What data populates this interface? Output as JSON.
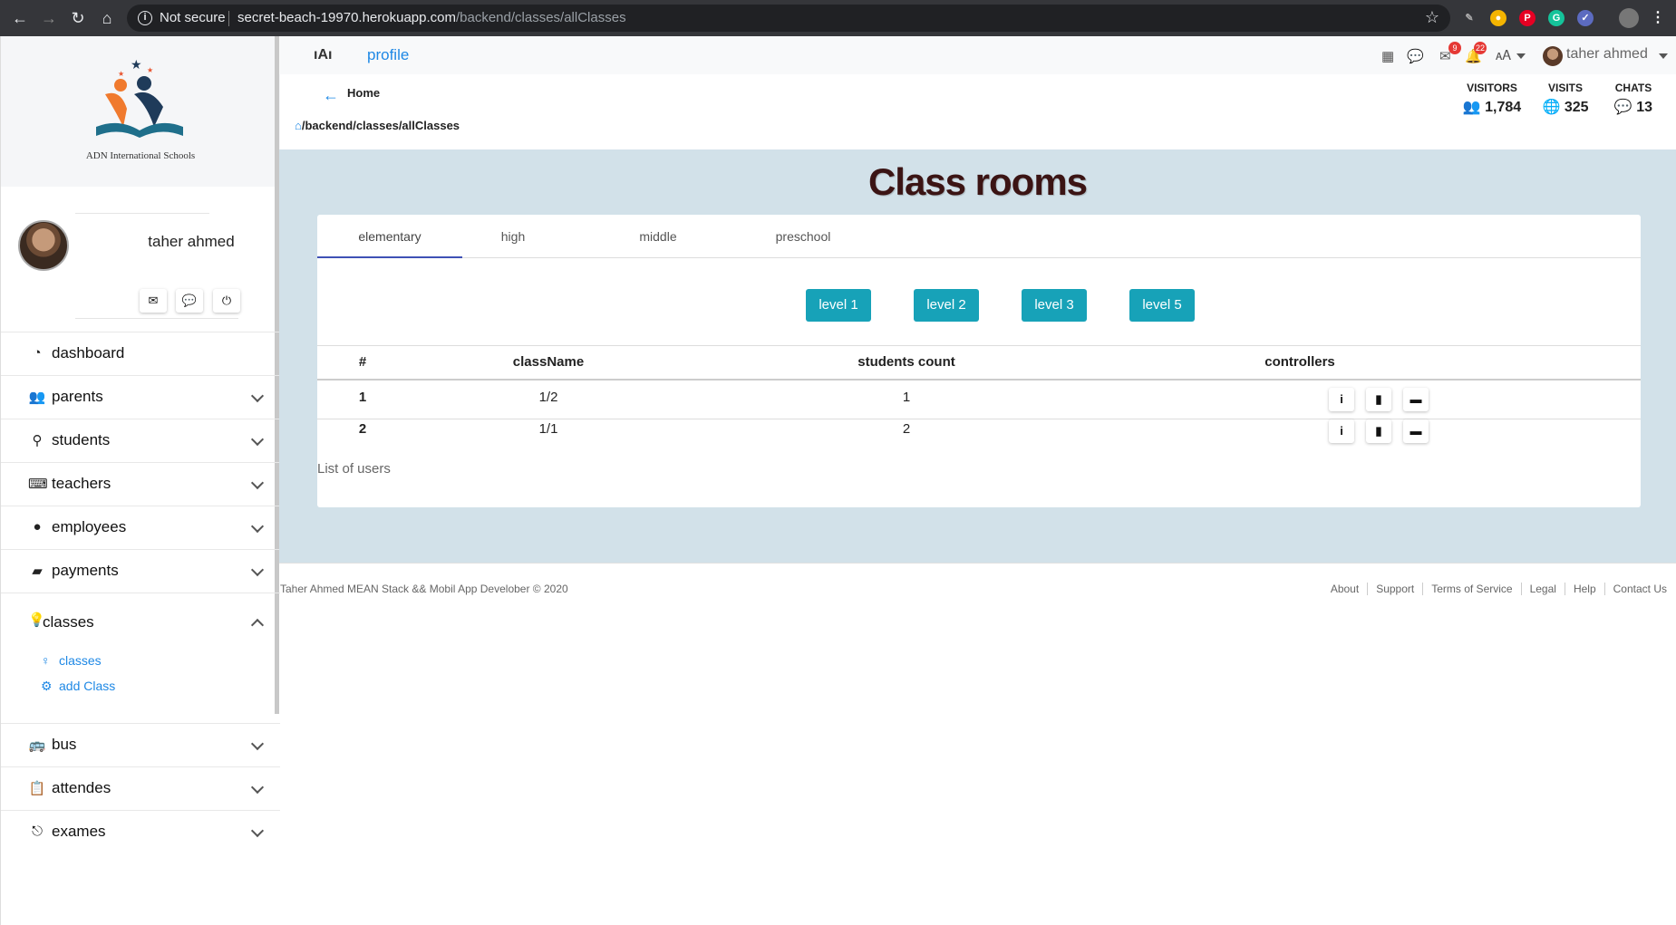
{
  "browser": {
    "security_label": "Not secure",
    "url_host": "secret-beach-19970.herokuapp.com",
    "url_path": "/backend/classes/allClasses"
  },
  "sidebar": {
    "logo_text": "ADN International Schools",
    "user_name": "taher ahmed",
    "nav": [
      {
        "label": "dashboard",
        "icon": "tachometer-icon"
      },
      {
        "label": "parents",
        "icon": "users-icon"
      },
      {
        "label": "students",
        "icon": "students-icon"
      },
      {
        "label": "teachers",
        "icon": "chalkboard-teacher-icon"
      },
      {
        "label": "employees",
        "icon": "user-icon"
      },
      {
        "label": "payments",
        "icon": "wallet-icon"
      }
    ],
    "classes_section": {
      "label": "classes",
      "children": [
        {
          "label": "classes",
          "icon": "lightbulb-icon"
        },
        {
          "label": "add Class",
          "icon": "users-cog-icon"
        }
      ]
    },
    "nav_bottom": [
      {
        "label": "bus",
        "icon": "bus-icon"
      },
      {
        "label": "attendes",
        "icon": "clipboard-icon"
      },
      {
        "label": "exames",
        "icon": "sign-out-icon"
      }
    ]
  },
  "topbar": {
    "profile_label": "profile",
    "mail_count": "9",
    "notif_count": "22",
    "user_name": "taher ahmed"
  },
  "header": {
    "back_label": "Home",
    "breadcrumb": "/backend/classes/allClasses",
    "stats": [
      {
        "title": "VISITORS",
        "value": "1,784"
      },
      {
        "title": "VISITS",
        "value": "325"
      },
      {
        "title": "CHATS",
        "value": "13"
      }
    ]
  },
  "main": {
    "title": "Class rooms",
    "tabs": [
      "elementary",
      "high",
      "middle",
      "preschool"
    ],
    "levels": [
      "level 1",
      "level 2",
      "level 3",
      "level 5"
    ],
    "table": {
      "headers": [
        "#",
        "className",
        "students count",
        "controllers"
      ],
      "rows": [
        {
          "num": "1",
          "className": "1/2",
          "count": "1"
        },
        {
          "num": "2",
          "className": "1/1",
          "count": "2"
        }
      ],
      "caption": "List of users"
    }
  },
  "footer": {
    "copyright": "Taher Ahmed MEAN Stack && Mobil App Develober © 2020",
    "links": [
      "About",
      "Support",
      "Terms of Service",
      "Legal",
      "Help",
      "Contact Us"
    ]
  },
  "colors": {
    "accent": "#1e88e5",
    "level_button": "#17a2b8",
    "content_bg": "#d2e1e9",
    "title": "#3b1414",
    "badge": "#e53935"
  }
}
